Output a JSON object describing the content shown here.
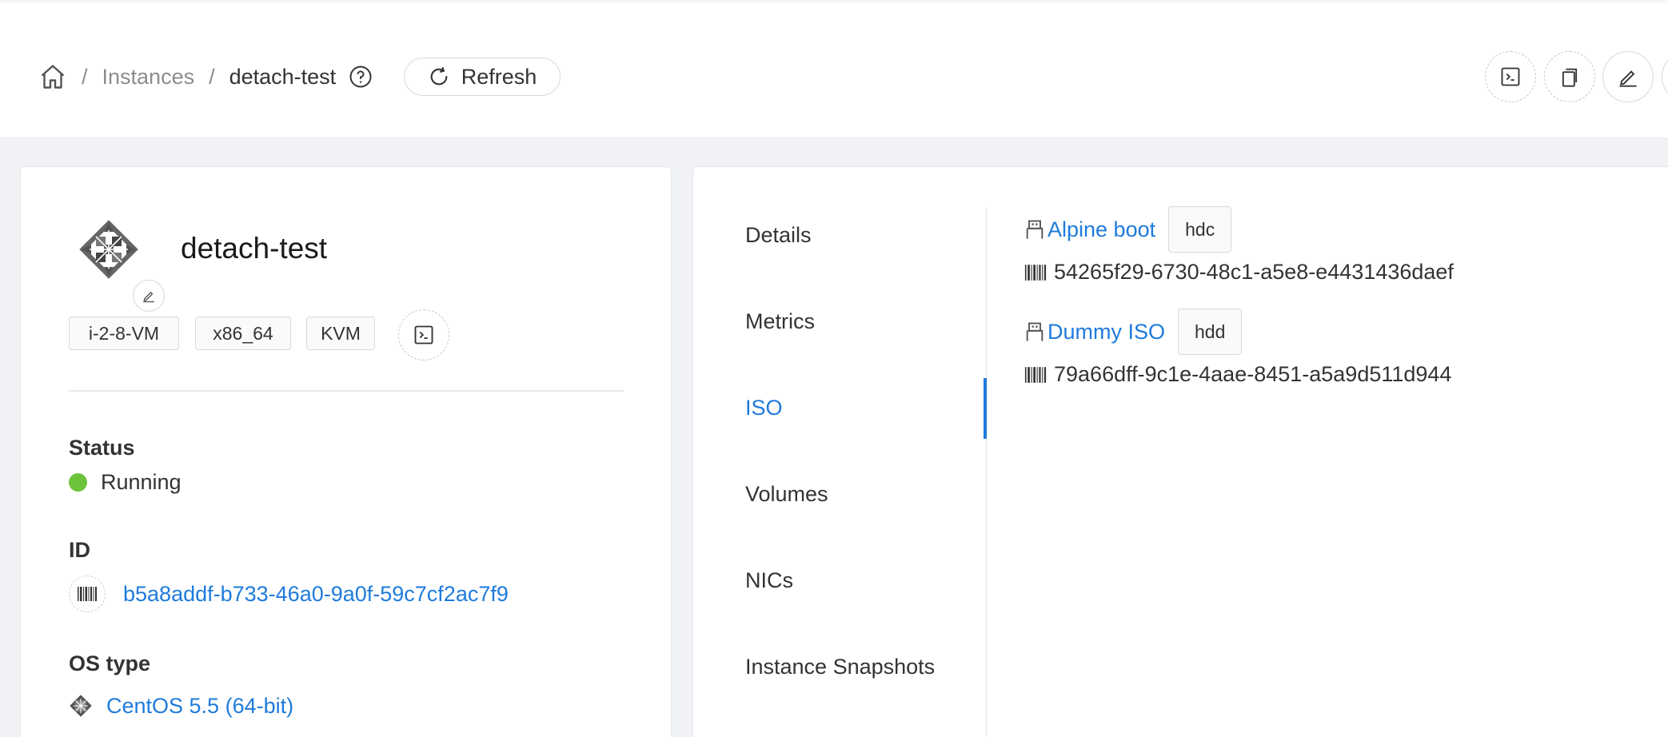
{
  "breadcrumb": {
    "items": [
      "Instances",
      "detach-test"
    ],
    "separator": "/"
  },
  "toolbar": {
    "refresh_label": "Refresh"
  },
  "instance": {
    "name": "detach-test",
    "tags": [
      "i-2-8-VM",
      "x86_64",
      "KVM"
    ],
    "status_label": "Status",
    "status_value": "Running",
    "status_color": "#6dc33a",
    "id_label": "ID",
    "id_value": "b5a8addf-b733-46a0-9a0f-59c7cf2ac7f9",
    "os_label": "OS type",
    "os_value": "CentOS 5.5 (64-bit)"
  },
  "tabs": [
    {
      "label": "Details",
      "active": false
    },
    {
      "label": "Metrics",
      "active": false
    },
    {
      "label": "ISO",
      "active": true
    },
    {
      "label": "Volumes",
      "active": false
    },
    {
      "label": "NICs",
      "active": false
    },
    {
      "label": "Instance Snapshots",
      "active": false
    }
  ],
  "isos": [
    {
      "name": "Alpine boot",
      "device": "hdc",
      "id": "54265f29-6730-48c1-a5e8-e4431436daef"
    },
    {
      "name": "Dummy ISO",
      "device": "hdd",
      "id": "79a66dff-9c1e-4aae-8451-a5a9d511d944"
    }
  ],
  "colors": {
    "accent": "#1e7bdc",
    "running": "#6dc33a"
  },
  "icons": [
    "home-icon",
    "question-circle-icon",
    "reload-icon",
    "code-icon",
    "copy-icon",
    "edit-icon",
    "barcode-icon",
    "usb-icon",
    "centos-logo-icon"
  ]
}
